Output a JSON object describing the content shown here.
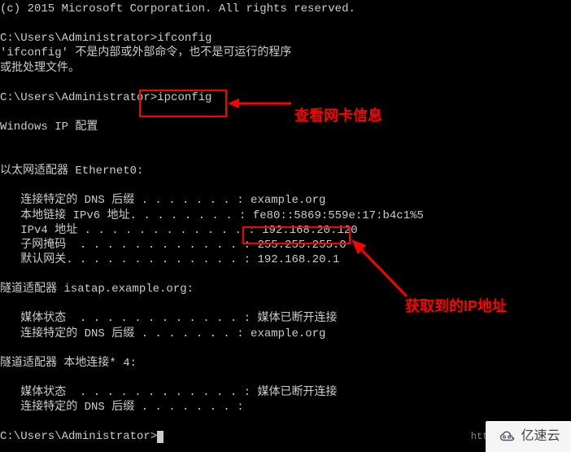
{
  "terminal": {
    "copyright": "(c) 2015 Microsoft Corporation. All rights reserved.",
    "prompt1": "C:\\Users\\Administrator>",
    "cmd_ifconfig": "ifconfig",
    "err_line1": "'ifconfig' 不是内部或外部命令，也不是可运行的程序",
    "err_line2": "或批处理文件。",
    "prompt2": "C:\\Users\\Administrator>",
    "cmd_ipconfig": "ipconfig",
    "win_ip_header": "Windows IP 配置",
    "adapter_eth": "以太网适配器 Ethernet0:",
    "dns_suffix_label": "   连接特定的 DNS 后缀 . . . . . . . : ",
    "dns_suffix_value": "example.org",
    "ipv6_label": "   本地链接 IPv6 地址. . . . . . . . : ",
    "ipv6_value": "fe80::5869:559e:17:b4c1%5",
    "ipv4_label": "   IPv4 地址 . . . . . . . . . . . . : ",
    "ipv4_value": "192.168.20.120",
    "subnet_label": "   子网掩码  . . . . . . . . . . . . : ",
    "subnet_value": "255.255.255.0",
    "gateway_label": "   默认网关. . . . . . . . . . . . . : ",
    "gateway_value": "192.168.20.1",
    "tunnel_isatap": "隧道适配器 isatap.example.org:",
    "media_label": "   媒体状态  . . . . . . . . . . . . : ",
    "media_value": "媒体已断开连接",
    "dns2_label": "   连接特定的 DNS 后缀 . . . . . . . : ",
    "dns2_value": "example.org",
    "tunnel_local": "隧道适配器 本地连接* 4:",
    "media2_label": "   媒体状态  . . . . . . . . . . . . : ",
    "media2_value": "媒体已断开连接",
    "dns3_label": "   连接特定的 DNS 后缀 . . . . . . . : ",
    "prompt3": "C:\\Users\\Administrator>"
  },
  "annotations": {
    "view_netcard": "查看网卡信息",
    "obtained_ip": "获取到的IP地址"
  },
  "watermark": {
    "url": "https://blog.csd",
    "brand": "亿速云"
  }
}
